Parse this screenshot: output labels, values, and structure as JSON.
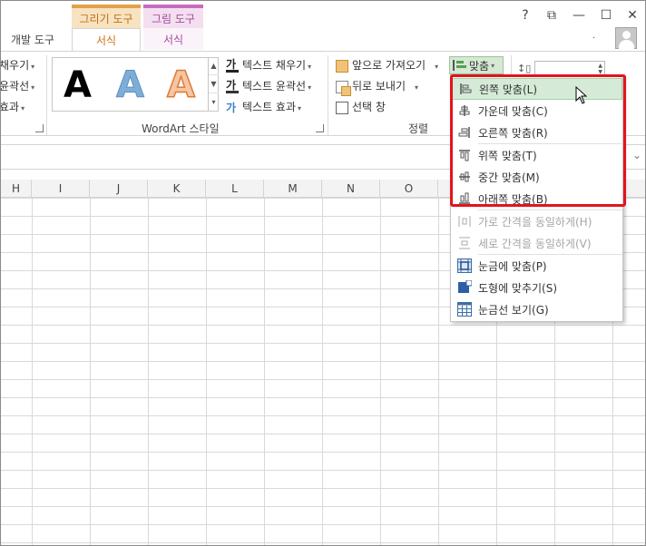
{
  "tabs": {
    "context_draw": "그리기 도구",
    "context_picture": "그림 도구",
    "developer": "개발 도구",
    "format_draw": "서식",
    "format_picture": "서식"
  },
  "window_controls": {
    "help": "?",
    "restore_ribbon": "⧉",
    "minimize": "—",
    "maximize": "☐",
    "close": "✕"
  },
  "account": {
    "dots": "·"
  },
  "ribbon": {
    "left_partial": [
      "채우기",
      "윤곽선",
      "효과"
    ],
    "wordart_letters": [
      "A",
      "A",
      "A"
    ],
    "text_fill": "텍스트 채우기",
    "text_outline": "텍스트 윤곽선",
    "text_effects": "텍스트 효과",
    "wordart_group_label": "WordArt 스타일",
    "bring_forward": "앞으로 가져오기",
    "send_backward": "뒤로 보내기",
    "selection_pane": "선택 창",
    "arrange_group_label": "정렬",
    "align_button": "맞춤",
    "ga_glyph": "가"
  },
  "columns": [
    "H",
    "I",
    "J",
    "K",
    "L",
    "M",
    "N",
    "O"
  ],
  "align_menu": {
    "items": [
      {
        "label": "왼쪽 맞춤(L)",
        "icon": "align-left-icon",
        "state": "hover"
      },
      {
        "label": "가운데 맞춤(C)",
        "icon": "align-center-icon",
        "state": "normal"
      },
      {
        "label": "오른쪽 맞춤(R)",
        "icon": "align-right-icon",
        "state": "normal"
      },
      {
        "label": "위쪽 맞춤(T)",
        "icon": "align-top-icon",
        "state": "normal"
      },
      {
        "label": "중간 맞춤(M)",
        "icon": "align-middle-icon",
        "state": "normal"
      },
      {
        "label": "아래쪽 맞춤(B)",
        "icon": "align-bottom-icon",
        "state": "normal"
      },
      {
        "label": "가로 간격을 동일하게(H)",
        "icon": "distribute-horizontal-icon",
        "state": "disabled"
      },
      {
        "label": "세로 간격을 동일하게(V)",
        "icon": "distribute-vertical-icon",
        "state": "disabled"
      },
      {
        "label": "눈금에 맞춤(P)",
        "icon": "snap-to-grid-icon",
        "state": "normal"
      },
      {
        "label": "도형에 맞추기(S)",
        "icon": "snap-to-shape-icon",
        "state": "normal"
      },
      {
        "label": "눈금선 보기(G)",
        "icon": "view-gridlines-icon",
        "state": "normal"
      }
    ]
  },
  "colors": {
    "accent_draw": "#e3a14b",
    "accent_picture": "#c86bbf",
    "highlight_box": "#e3141b",
    "menu_hover": "#d5ebd8"
  }
}
